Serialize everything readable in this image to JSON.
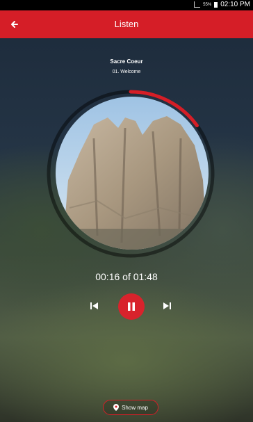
{
  "status_bar": {
    "battery_text": "55%",
    "time": "02:10 PM"
  },
  "app_bar": {
    "title": "Listen",
    "back_icon": "arrow-left-icon"
  },
  "player": {
    "place_name": "Sacre Coeur",
    "track_title": "01. Welcome",
    "time_readout": "00:16 of 01:48",
    "progress_fraction": 0.15,
    "accent_color": "#d51e27"
  },
  "controls": {
    "previous_icon": "skip-previous-icon",
    "pause_icon": "pause-icon",
    "next_icon": "skip-next-icon"
  },
  "map_button": {
    "label": "Show map",
    "icon": "map-pin-icon"
  }
}
